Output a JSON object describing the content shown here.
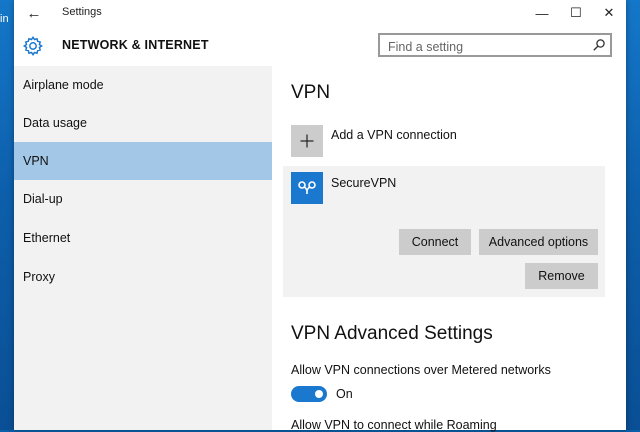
{
  "desktop": {
    "edge_text": "in"
  },
  "window": {
    "title": "Settings",
    "back_glyph": "←",
    "minimize_glyph": "—",
    "maximize_glyph": "☐",
    "close_glyph": "✕"
  },
  "header": {
    "section_title": "NETWORK & INTERNET",
    "search_placeholder": "Find a setting"
  },
  "sidebar": {
    "items": [
      {
        "label": "Airplane mode",
        "active": false
      },
      {
        "label": "Data usage",
        "active": false
      },
      {
        "label": "VPN",
        "active": true
      },
      {
        "label": "Dial-up",
        "active": false
      },
      {
        "label": "Ethernet",
        "active": false
      },
      {
        "label": "Proxy",
        "active": false
      }
    ]
  },
  "vpn": {
    "heading": "VPN",
    "add_label": "Add a VPN connection",
    "connection_name": "SecureVPN",
    "connect_label": "Connect",
    "advanced_label": "Advanced options",
    "remove_label": "Remove"
  },
  "advanced": {
    "heading": "VPN Advanced Settings",
    "metered_label": "Allow VPN connections over Metered networks",
    "metered_state": "On",
    "metered_on": true,
    "roaming_label": "Allow VPN to connect while Roaming"
  },
  "colors": {
    "accent": "#1b78cf",
    "selected_nav": "#a3c7e6",
    "sidebar_bg": "#f2f2f2",
    "button_bg": "#cccccc"
  },
  "icons": [
    "back-arrow-icon",
    "gear-icon",
    "search-icon",
    "plus-icon",
    "vpn-logo-icon"
  ]
}
